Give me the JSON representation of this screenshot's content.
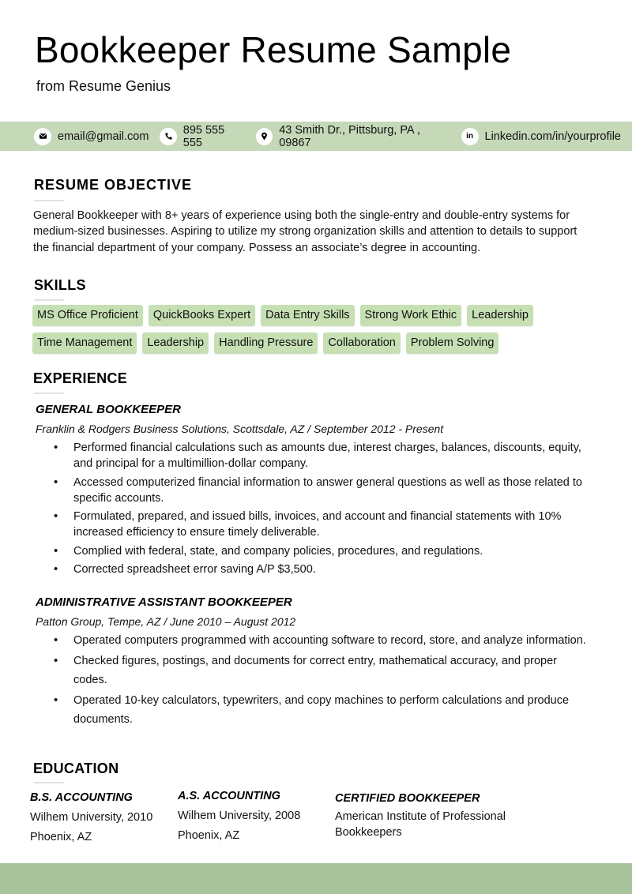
{
  "header": {
    "title": "Bookkeeper Resume Sample",
    "subtitle": "from Resume Genius"
  },
  "contact": {
    "bar_color": "#c5d8b8",
    "items": [
      {
        "icon": "envelope-icon",
        "text": "email@gmail.com"
      },
      {
        "icon": "phone-icon",
        "text": "895 555 555"
      },
      {
        "icon": "map-pin-icon",
        "text": "43 Smith Dr., Pittsburg, PA , 09867"
      },
      {
        "icon": "linkedin-icon",
        "glyph": "in",
        "text": "Linkedin.com/in/yourprofile"
      }
    ]
  },
  "objective": {
    "heading": "RESUME OBJECTIVE",
    "text": "General Bookkeeper with 8+ years of experience using both the single-entry and double-entry systems for medium-sized businesses. Aspiring to utilize my strong organization skills and attention to details to support the financial department of your company. Possess an associate’s degree in accounting."
  },
  "skills": {
    "heading": "SKILLS",
    "tag_color": "#c6e0b4",
    "rows": [
      [
        "MS Office Proficient",
        "QuickBooks Expert",
        "Data Entry Skills",
        "Strong Work Ethic",
        "Leadership"
      ],
      [
        "Time Management",
        "Leadership",
        "Handling Pressure",
        "Collaboration",
        "Problem Solving"
      ]
    ]
  },
  "experience": {
    "heading": "EXPERIENCE",
    "jobs": [
      {
        "title": "GENERAL BOOKKEEPER",
        "meta": "Franklin & Rodgers Business Solutions, Scottsdale, AZ  /  September 2012 - Present",
        "bullets": [
          "Performed financial calculations such as amounts due, interest charges, balances, discounts, equity, and principal for a multimillion-dollar company.",
          "Accessed computerized financial information to answer general questions as well as those related to specific accounts.",
          "Formulated, prepared, and issued bills, invoices, and account and financial statements with 10% increased efficiency to ensure timely deliverable.",
          "Complied with federal, state, and company policies, procedures, and regulations.",
          "Corrected spreadsheet error saving A/P $3,500."
        ]
      },
      {
        "title": "ADMINISTRATIVE ASSISTANT BOOKKEEPER",
        "meta": "Patton Group, Tempe, AZ  /  June 2010 – August 2012",
        "bullets": [
          "Operated computers programmed with accounting software to record, store, and analyze information.",
          "Checked figures, postings, and documents for correct entry, mathematical accuracy, and proper codes.",
          "Operated 10-key calculators, typewriters, and copy machines to perform calculations and produce documents."
        ]
      }
    ]
  },
  "education": {
    "heading": "EDUCATION",
    "entries": [
      {
        "degree": "B.S. ACCOUNTING",
        "lines": [
          "Wilhem University, 2010",
          "Phoenix, AZ"
        ]
      },
      {
        "degree": "A.S. ACCOUNTING",
        "lines": [
          "Wilhem University, 2008",
          "Phoenix, AZ"
        ]
      },
      {
        "degree": "CERTIFIED BOOKKEEPER",
        "lines": [
          "American Institute of Professional",
          "Bookkeepers"
        ]
      }
    ]
  },
  "footer": {
    "bar_color": "#a9c49c"
  }
}
